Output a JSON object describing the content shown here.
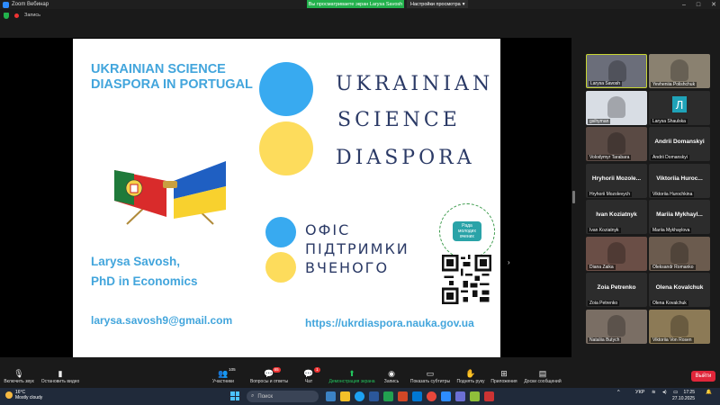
{
  "window": {
    "app_title": "Zoom Вебинар",
    "share_banner": "Вы просматриваете экран Larysa Savosh",
    "view_options": "Настройки просмотра",
    "controls": [
      "–",
      "□",
      "✕"
    ]
  },
  "status": {
    "recording": "Запись"
  },
  "slide": {
    "title": "UKRAINIAN SCIENCE DIASPORA IN PORTUGAL",
    "logo_words": [
      "UKRAINIAN",
      "SCIENCE",
      "DIASPORA"
    ],
    "office_words": [
      "ОФІС",
      "ПІДТРИМКИ",
      "ВЧЕНОГО"
    ],
    "presenter_name": "Larysa Savosh,",
    "presenter_degree": "PhD in Economics",
    "email": "larysa.savosh9@gmail.com",
    "url": "https://ukrdiaspora.nauka.gov.ua",
    "badge_text": "Рада молодих вчених",
    "colors": {
      "blue": "#38aaf0",
      "yellow": "#fddc5c",
      "title": "#42a5dc",
      "navy": "#2b3a66"
    }
  },
  "gallery": {
    "tiles": [
      {
        "label": "Larysa Savosh",
        "big": "",
        "active": true
      },
      {
        "label": "Yevheniia Polishchuk",
        "big": ""
      },
      {
        "label": "gsihyman",
        "big": ""
      },
      {
        "label": "Larysa Shaulska",
        "big": "Л"
      },
      {
        "label": "Volodymyr Tarabara",
        "big": ""
      },
      {
        "label": "Andrii Domanskyi",
        "big": "Andrii Domanskyi"
      },
      {
        "label": "Hryhorii Mozolevych",
        "big": "Hryhorii Mozole..."
      },
      {
        "label": "Viktoriia Hurochkina",
        "big": "Viktoriia Huroc..."
      },
      {
        "label": "Ivan Koziatnyk",
        "big": "Ivan Koziatnyk"
      },
      {
        "label": "Mariia Mykhaylova",
        "big": "Mariia Mykhayl..."
      },
      {
        "label": "Diana Zaika",
        "big": ""
      },
      {
        "label": "Oleksandr Romanko",
        "big": ""
      },
      {
        "label": "Zoia Petrenko",
        "big": "Zoia Petrenko"
      },
      {
        "label": "Olena Kovalchuk",
        "big": "Olena Kovalchuk"
      },
      {
        "label": "Nataliia Butych",
        "big": ""
      },
      {
        "label": "Viktoriia Von Rosen",
        "big": ""
      }
    ]
  },
  "toolbar": {
    "unmute": "Включить звук",
    "stop_video": "Остановить видео",
    "participants": "Участники",
    "participants_count": "105",
    "qa": "Вопросы и ответы",
    "qa_badge": "65",
    "chat": "Чат",
    "chat_badge": "1",
    "screen_demo": "Демонстрация экрана",
    "record": "Запись",
    "captions": "Показать субтитры",
    "raise_hand": "Поднять руку",
    "apps": "Приложения",
    "whiteboard": "Доски сообщений",
    "leave": "Выйти"
  },
  "taskbar": {
    "temperature": "16°C",
    "weather": "Mostly cloudy",
    "search_placeholder": "Поиск",
    "language": "УКР",
    "time": "17:25",
    "date": "27.10.2025"
  }
}
